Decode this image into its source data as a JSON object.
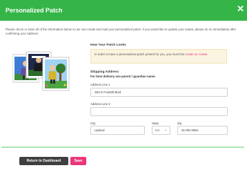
{
  "header": {
    "title": "Personalized Patch",
    "close_symbol": "✕",
    "accent_color": "#35b548"
  },
  "intro_text": "Please check or enter all of the information below so we can create and mail your personalized patch. If you would like to update your avatar, please do so immediately after confirming your address.",
  "preview": {
    "heading": "How Your Patch Looks"
  },
  "alert": {
    "text": "In order to have a personalized patch printed for you, you must first ",
    "link_text": "create an Avatar."
  },
  "shipping": {
    "heading": "Shipping Address",
    "subheading": "For best delivery use parent / guardian name.",
    "address1_label": "Address Line 1",
    "address1_value": "393 E Foothill Blvd",
    "address2_label": "Address Line 2",
    "address2_value": "",
    "city_label": "City",
    "city_value": "Upland",
    "state_label": "State",
    "state_value": "CA",
    "zip_label": "Zip",
    "zip_value": "91786-3962"
  },
  "buttons": {
    "dashboard_label": "Return to Dashboard",
    "save_label": "Save",
    "save_color": "#e8377a"
  }
}
